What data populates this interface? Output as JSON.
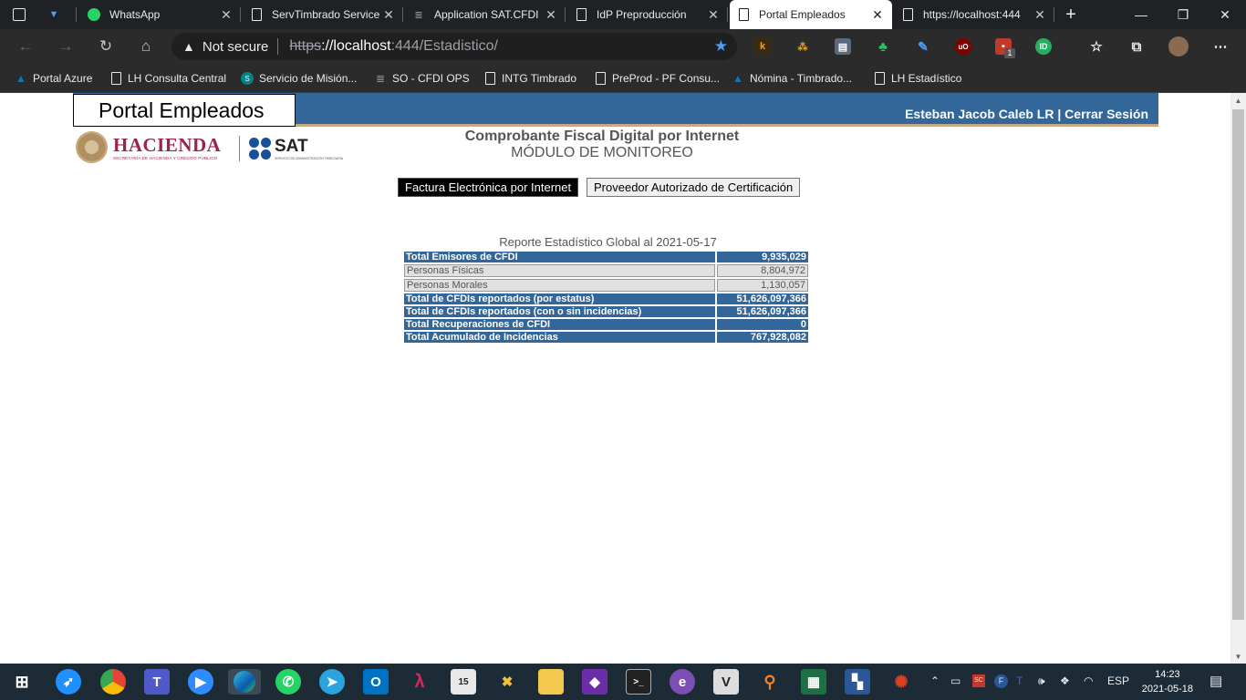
{
  "browser": {
    "tabs": [
      {
        "title": "",
        "icon": "sidebar-icon"
      },
      {
        "title": "",
        "icon": "pin-icon"
      },
      {
        "title": "WhatsApp",
        "icon": "whatsapp-icon"
      },
      {
        "title": "ServTimbrado Service",
        "icon": "page-icon"
      },
      {
        "title": "Application SAT.CFDI",
        "icon": "stackoverflow-icon"
      },
      {
        "title": "IdP Preproducción",
        "icon": "page-icon"
      },
      {
        "title": "Portal Empleados",
        "icon": "page-icon"
      },
      {
        "title": "https://localhost:444",
        "icon": "page-icon"
      }
    ],
    "address": {
      "security_label": "Not secure",
      "scheme": "https",
      "host": "://localhost",
      "path": ":444/Estadistico/"
    },
    "bookmarks": [
      {
        "label": "Portal Azure",
        "icon": "azure-icon"
      },
      {
        "label": "LH Consulta Central",
        "icon": "page-icon"
      },
      {
        "label": "Servicio de Misión...",
        "icon": "sharepoint-icon"
      },
      {
        "label": "SO - CFDI OPS",
        "icon": "stackoverflow-icon"
      },
      {
        "label": "INTG Timbrado",
        "icon": "page-icon"
      },
      {
        "label": "PreProd - PF Consu...",
        "icon": "page-icon"
      },
      {
        "label": "Nómina - Timbrado...",
        "icon": "azure-icon"
      },
      {
        "label": "LH Estadístico",
        "icon": "page-icon"
      }
    ],
    "extension_badge": "1"
  },
  "page": {
    "portal_title": "Portal Empleados",
    "user_name": "Esteban Jacob Caleb LR",
    "separator": " | ",
    "logout_label": "Cerrar Sesión",
    "logo_hacienda": "HACIENDA",
    "logo_hacienda_sub": "SECRETARÍA DE HACIENDA Y CRÉDITO PÚBLICO",
    "logo_sat": "SAT",
    "logo_sat_sub": "SERVICIO DE ADMINISTRACIÓN TRIBUTARIA",
    "main_title": "Comprobante Fiscal Digital por Internet",
    "subtitle": "MÓDULO DE MONITOREO",
    "buttons": {
      "fei": "Factura Electrónica por Internet",
      "pac": "Proveedor Autorizado de Certificación"
    },
    "report": {
      "title": "Reporte Estadístico Global al 2021-05-17",
      "rows": [
        {
          "label": "Total Emisores de CFDI",
          "value": "9,935,029"
        },
        {
          "label": "Personas Físicas",
          "value": "8,804,972"
        },
        {
          "label": "Personas Morales",
          "value": "1,130,057"
        },
        {
          "label": "Total de CFDIs reportados (por estatus)",
          "value": "51,626,097,366"
        },
        {
          "label": "Total de CFDIs reportados (con o sin incidencias)",
          "value": "51,626,097,366"
        },
        {
          "label": "Total Recuperaciones de CFDI",
          "value": "0"
        },
        {
          "label": "Total Acumulado de Incidencias",
          "value": "767,928,082"
        }
      ]
    },
    "colors": {
      "header_blue": "#336699",
      "accent_gold": "#c8a882",
      "hacienda_red": "#9d2449",
      "sat_blue": "#1a4f9c"
    }
  },
  "taskbar": {
    "language": "ESP",
    "time": "14:23",
    "date": "2021-05-18"
  }
}
